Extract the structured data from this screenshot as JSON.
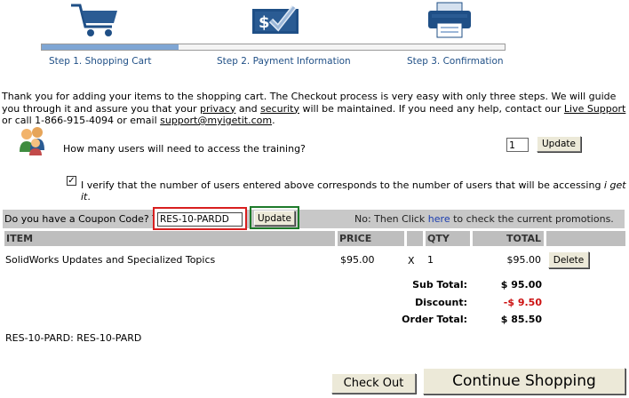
{
  "steps": [
    {
      "label": "Step 1. Shopping Cart",
      "icon": "shopping-cart-icon"
    },
    {
      "label": "Step 2. Payment Information",
      "icon": "payment-check-icon"
    },
    {
      "label": "Step 3. Confirmation",
      "icon": "printer-icon"
    }
  ],
  "progress": {
    "current_step": 1,
    "total_steps": 3
  },
  "intro": {
    "part1": "Thank you for adding your items to the shopping cart. The Checkout process is very easy with only three steps. We will guide you through it and assure you that your ",
    "privacy": "privacy",
    "and": " and ",
    "security": "security",
    "part2": " will be maintained. If you need any help, contact our ",
    "live_support": "Live Support",
    "part3": " or call 1-866-915-4094 or email ",
    "email": "support@myigetit.com",
    "part4": "."
  },
  "users": {
    "question": "How many users will need to access the training?",
    "value": "1",
    "update_label": "Update"
  },
  "verify": {
    "checked": true,
    "text": "I verify that the number of users entered above corresponds to the number of users that will be accessing ",
    "brand": "i get it",
    "end": "."
  },
  "coupon": {
    "question": "Do you have a Coupon Code? Yes:",
    "value": "RES-10-PARDD",
    "update_label": "Update",
    "promo_prefix": "No: Then Click ",
    "promo_link": "here",
    "promo_suffix": " to check the current promotions."
  },
  "table": {
    "headers": {
      "item": "ITEM",
      "price": "PRICE",
      "qty": "QTY",
      "total": "TOTAL"
    },
    "rows": [
      {
        "item": "SolidWorks Updates and Specialized Topics",
        "price": "$95.00",
        "x": "X",
        "qty": "1",
        "total": "$95.00",
        "delete": "Delete"
      }
    ]
  },
  "summary": {
    "subtotal_label": "Sub Total:",
    "subtotal": "$ 95.00",
    "discount_label": "Discount:",
    "discount": "-$ 9.50",
    "order_label": "Order Total:",
    "order_total": "$ 85.50"
  },
  "applied_coupon": "RES-10-PARD: RES-10-PARD",
  "buttons": {
    "checkout": "Check Out",
    "continue": "Continue Shopping"
  },
  "colors": {
    "step_label": "#1f4f86",
    "progress_fill": "#7fa6d4",
    "discount": "#cc1111",
    "coupon_highlight": "#d81f1f",
    "update_highlight": "#1e7a2a"
  }
}
